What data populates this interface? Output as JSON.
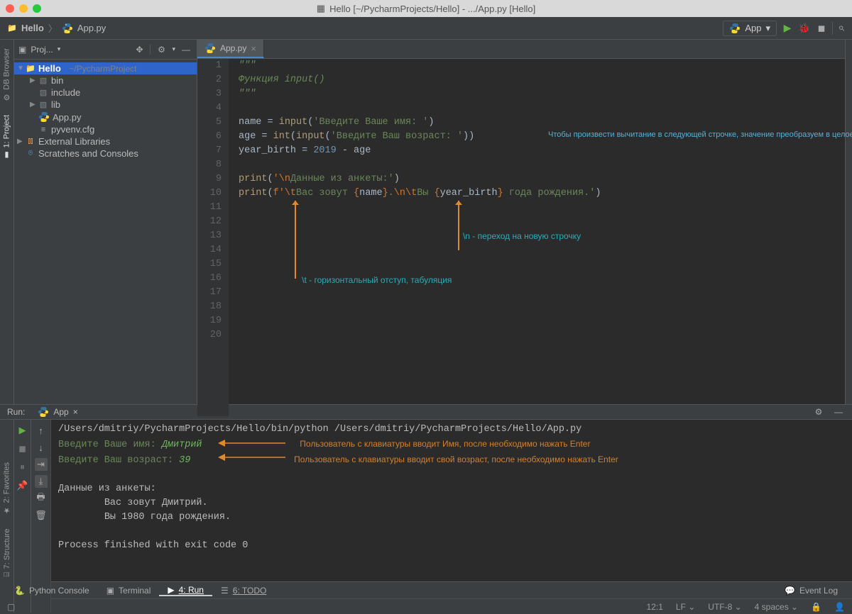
{
  "titlebar": {
    "text": "Hello [~/PycharmProjects/Hello] - .../App.py [Hello]"
  },
  "toolbar": {
    "breadcrumb": {
      "project": "Hello",
      "file": "App.py"
    },
    "runconfig": "App"
  },
  "project_panel": {
    "title": "Proj...",
    "root": "Hello",
    "root_path": "~/PycharmProject",
    "items": [
      "bin",
      "include",
      "lib"
    ],
    "file1": "App.py",
    "file2": "pyvenv.cfg",
    "ext": "External Libraries",
    "scr": "Scratches and Consoles"
  },
  "rails": {
    "db": "DB Browser",
    "project": "1: Project",
    "fav": "2: Favorites",
    "struct": "7: Structure"
  },
  "editor": {
    "tab": "App.py",
    "lines": [
      "1",
      "2",
      "3",
      "4",
      "5",
      "6",
      "7",
      "8",
      "9",
      "10",
      "11",
      "12",
      "13",
      "14",
      "15",
      "16",
      "17",
      "18",
      "19",
      "20"
    ],
    "code": {
      "l1": "\"\"\"",
      "l2": "Функция input()",
      "l3": "\"\"\"",
      "l5a": "name = ",
      "l5fn": "input",
      "l5b": "(",
      "l5s": "'Введите Ваше имя: '",
      "l5c": ")",
      "l6a": "age = ",
      "l6fn": "int",
      "l6b": "(",
      "l6fn2": "input",
      "l6c": "(",
      "l6s": "'Введите Ваш возраст: '",
      "l6d": "))",
      "l7a": "year_birth = ",
      "l7n": "2019",
      "l7b": " - age",
      "l9fn": "print",
      "l9a": "(",
      "l9e1": "'\\n",
      "l9s": "Данные из анкеты:'",
      "l9b": ")",
      "l10fn": "print",
      "l10a": "(",
      "l10f": "f'",
      "l10e1": "\\t",
      "l10s1": "Вас зовут ",
      "l10b1": "{",
      "l10v1": "name",
      "l10b2": "}",
      "l10s2": ".",
      "l10e2": "\\n\\t",
      "l10s3": "Вы ",
      "l10b3": "{",
      "l10v2": "year_birth",
      "l10b4": "}",
      "l10s4": " года рождения.'",
      "l10c": ")"
    },
    "annotation_right": "Чтобы произвести вычитание в следующей строчке, значение преобразуем в целое число, с помощью функции int(), иначе получим ОШИБКУ (так как input() возвращает строку).",
    "annotation_n": "\\n - переход на новую строчку",
    "annotation_t": "\\t - горизонтальный отступ, табуляция"
  },
  "run": {
    "label": "Run:",
    "tab": "App",
    "cmd": "/Users/dmitriy/PycharmProjects/Hello/bin/python /Users/dmitriy/PycharmProjects/Hello/App.py",
    "p1": "Введите Ваше имя: ",
    "u1": "Дмитрий",
    "p2": "Введите Ваш возраст: ",
    "u2": "39",
    "out1": "Данные из анкеты:",
    "out2": "\tВас зовут Дмитрий.",
    "out3": "\tВы 1980 года рождения.",
    "exit": "Process finished with exit code 0",
    "annot1": "Пользователь с клавиатуры вводит Имя, после необходимо нажать Enter",
    "annot2": "Пользователь с клавиатуры вводит свой возраст, после необходимо нажать Enter"
  },
  "bottom": {
    "console": "Python Console",
    "terminal": "Terminal",
    "run": "4: Run",
    "todo": "6: TODO",
    "eventlog": "Event Log"
  },
  "status": {
    "pos": "12:1",
    "lf": "LF",
    "enc": "UTF-8",
    "indent": "4 spaces"
  }
}
